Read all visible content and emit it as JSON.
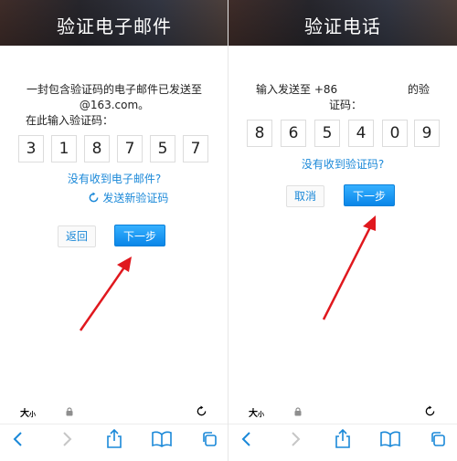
{
  "left": {
    "title": "验证电子邮件",
    "msg_line1": "一封包含验证码的电子邮件已发送至",
    "msg_line2": "@163.com。",
    "msg_line3": "在此输入验证码：",
    "digits": [
      "3",
      "1",
      "8",
      "7",
      "5",
      "7"
    ],
    "no_receive": "没有收到电子邮件?",
    "resend": "发送新验证码",
    "back_label": "返回",
    "next_label": "下一步"
  },
  "right": {
    "title": "验证电话",
    "msg_prefix": "输入发送至 +86",
    "msg_suffix": "的验",
    "msg_line2": "证码：",
    "digits": [
      "8",
      "6",
      "5",
      "4",
      "0",
      "9"
    ],
    "no_receive": "没有收到验证码?",
    "cancel_label": "取消",
    "next_label": "下一步"
  },
  "browser": {
    "text_size_big": "大",
    "text_size_small": "小"
  },
  "colors": {
    "accent": "#1a88d8",
    "arrow": "#e0181e",
    "button_blue": "#0a86e8"
  }
}
